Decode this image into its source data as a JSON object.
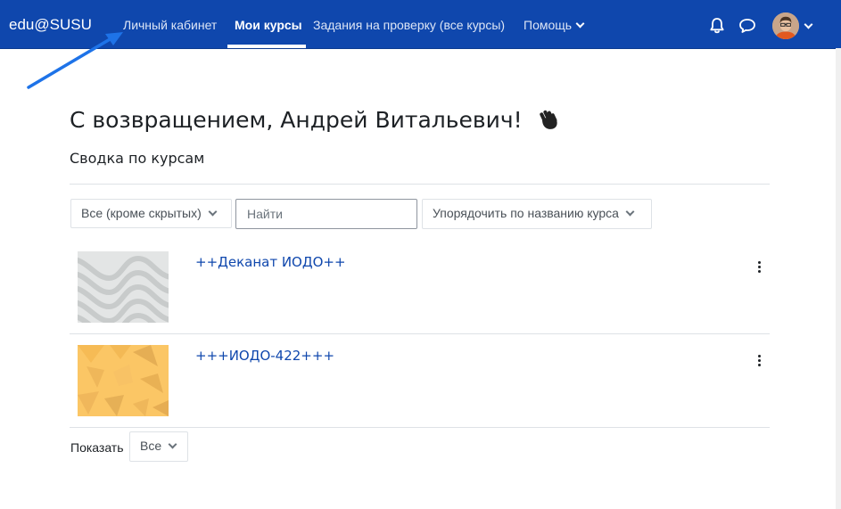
{
  "navbar": {
    "brand": "edu@SUSU",
    "items": [
      {
        "label": "Личный кабинет"
      },
      {
        "label": "Мои курсы",
        "active": true
      },
      {
        "label": "Задания на проверку (все курсы)"
      },
      {
        "label": "Помощь"
      }
    ],
    "icons": [
      "bell-icon",
      "chat-icon",
      "user-avatar",
      "chevron-down-icon"
    ],
    "color": "#0f47ad"
  },
  "page": {
    "welcome": "С возвращением, Андрей Витальевич!",
    "wave_icon": "waving-hand-icon",
    "section_title": "Сводка по курсам"
  },
  "filters": {
    "grouping": "Все (кроме скрытых)",
    "search_placeholder": "Найти",
    "sort": "Упорядочить по названию курса"
  },
  "courses": [
    {
      "name": "++Деканат ИОДО++",
      "image": "grey-waves-pattern"
    },
    {
      "name": "+++ИОДО-422+++",
      "image": "orange-geometric-pattern"
    }
  ],
  "paging": {
    "show_label": "Показать",
    "show_value": "Все"
  },
  "annotation": {
    "arrow_color": "#1e73e8"
  }
}
